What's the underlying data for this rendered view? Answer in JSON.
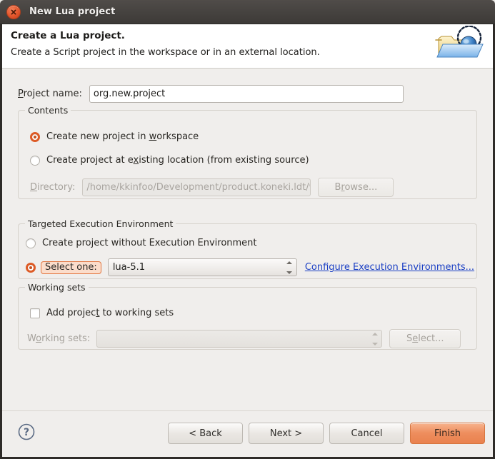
{
  "window": {
    "title": "New Lua project",
    "close_icon": "close-icon"
  },
  "header": {
    "title": "Create a Lua project.",
    "subtitle": "Create a Script project in the workspace or in an external location.",
    "banner_icon": "new-project-folder-icon"
  },
  "project_name": {
    "label_pre": "",
    "label_mnemonic": "P",
    "label_post": "roject name:",
    "value": "org.new.project",
    "placeholder": ""
  },
  "contents": {
    "group_title": "Contents",
    "option_new": {
      "label_pre": "Create new project in ",
      "label_mnemonic": "w",
      "label_post": "orkspace",
      "selected": true
    },
    "option_existing": {
      "label_pre": "Create project at e",
      "label_mnemonic": "x",
      "label_post": "isting location (from existing source)",
      "selected": false
    },
    "directory": {
      "label_pre": "",
      "label_mnemonic": "D",
      "label_post": "irectory:",
      "value": "/home/kkinfoo/Development/product.koneki.ldt/workspace/c",
      "enabled": false
    },
    "browse_button": {
      "label_pre": "B",
      "label_mnemonic": "r",
      "label_post": "owse...",
      "enabled": false
    }
  },
  "execution_environment": {
    "group_title": "Targeted Execution Environment",
    "option_without": {
      "label": "Create project without Execution Environment",
      "selected": false
    },
    "option_select_one": {
      "label": "Select one:",
      "selected": true,
      "focused": true
    },
    "combo_value": "lua-5.1",
    "configure_link": "Configure Execution Environments..."
  },
  "working_sets": {
    "group_title": "Working sets",
    "checkbox": {
      "label_pre": "Add projec",
      "label_mnemonic": "t",
      "label_post": " to working sets",
      "checked": false
    },
    "combo_label_pre": "W",
    "combo_label_mnemonic": "o",
    "combo_label_post": "rking sets:",
    "combo_value": "",
    "select_button": {
      "label_pre": "S",
      "label_mnemonic": "e",
      "label_post": "lect...",
      "enabled": false
    }
  },
  "footer": {
    "help_icon": "help-question-icon",
    "back_button": "< Back",
    "next_button": "Next >",
    "cancel_button": "Cancel",
    "finish_button": "Finish"
  },
  "colors": {
    "accent_orange": "#dd5b26",
    "finish_orange": "#ee8e5e",
    "link_blue": "#1a3fc4",
    "titlebar_dark": "#464340",
    "body_grey": "#f0eeec"
  }
}
